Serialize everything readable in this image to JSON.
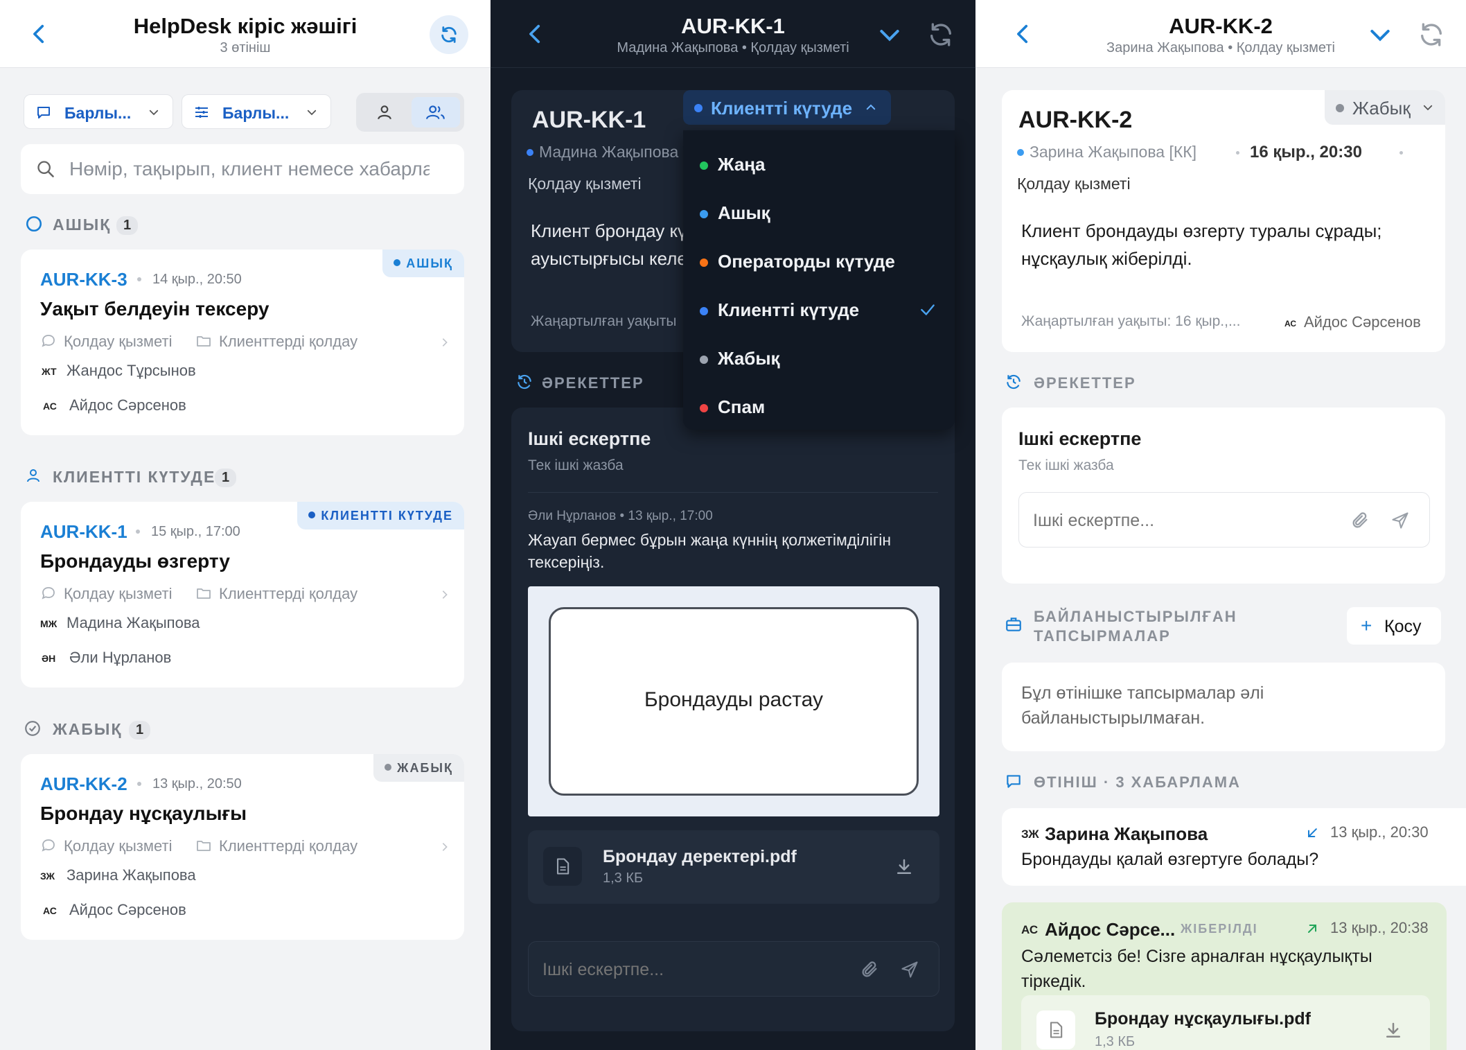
{
  "inbox": {
    "title": "HelpDesk кіріс жәшігі",
    "subtitle": "3 өтініш",
    "filter1": "Барлы...",
    "filter2": "Барлы...",
    "search_placeholder": "Нөмір, тақырып, клиент немесе хабарлама",
    "sections": [
      {
        "label": "АШЫҚ",
        "count": "1"
      },
      {
        "label": "КЛИЕНТТІ КҮТУДЕ",
        "count": "1"
      },
      {
        "label": "ЖАБЫҚ",
        "count": "1"
      }
    ],
    "tickets": [
      {
        "id": "AUR-KK-3",
        "date": "14 қыр., 20:50",
        "title": "Уақыт белдеуін тексеру",
        "badge": "АШЫҚ",
        "channel": "Қолдау қызметі",
        "queue": "Клиенттерді қолдау",
        "client_initials": "ЖТ",
        "client": "Жандос Тұрсынов",
        "agent_initials": "АС",
        "agent": "Айдос Сәрсенов"
      },
      {
        "id": "AUR-KK-1",
        "date": "15 қыр., 17:00",
        "title": "Брондауды өзгерту",
        "badge": "КЛИЕНТТІ КҮТУДЕ",
        "channel": "Қолдау қызметі",
        "queue": "Клиенттерді қолдау",
        "client_initials": "МЖ",
        "client": "Мадина Жақыпова",
        "agent_initials": "ӘН",
        "agent": "Әли Нұрланов"
      },
      {
        "id": "AUR-KK-2",
        "date": "13 қыр., 20:50",
        "title": "Брондау нұсқаулығы",
        "badge": "ЖАБЫҚ",
        "channel": "Қолдау қызметі",
        "queue": "Клиенттерді қолдау",
        "client_initials": "ЗЖ",
        "client": "Зарина Жақыпова",
        "agent_initials": "АС",
        "agent": "Айдос Сәрсенов"
      }
    ]
  },
  "detail1": {
    "title": "AUR-KK-1",
    "subtitle": "Мадина Жақыпова • Қолдау қызметі",
    "ticket_id": "AUR-KK-1",
    "status": "Клиентті күтуде",
    "client": "Мадина Жақыпова",
    "channel": "Қолдау қызметі",
    "summary_line1": "Клиент брондау күнін",
    "summary_line2": "ауыстырғысы келеді.",
    "updated": "Жаңартылған уақыты",
    "actions_label": "ӘРЕКЕТТЕР",
    "note_title": "Ішкі ескертпе",
    "note_sub": "Тек ішкі жазба",
    "note_author": "Әли Нұрланов • 13 қыр., 17:00",
    "note_text_line1": "Жауап бермес бұрын жаңа күннің қолжетімділігін",
    "note_text_line2": "тексеріңіз.",
    "preview_label": "Брондауды растау",
    "file_name": "Брондау деректері.pdf",
    "file_size": "1,3 КБ",
    "input_placeholder": "Ішкі ескертпе...",
    "menu": [
      {
        "label": "Жаңа",
        "color": "#22c55e"
      },
      {
        "label": "Ашық",
        "color": "#3b9cf0"
      },
      {
        "label": "Операторды күтуде",
        "color": "#f97316"
      },
      {
        "label": "Клиентті күтуде",
        "color": "#3b82f6",
        "selected": true
      },
      {
        "label": "Жабық",
        "color": "#9ca3af"
      },
      {
        "label": "Спам",
        "color": "#ef4444"
      }
    ]
  },
  "detail2": {
    "title": "AUR-KK-2",
    "subtitle": "Зарина Жақыпова • Қолдау қызметі",
    "ticket_id": "AUR-KK-2",
    "status": "Жабық",
    "client": "Зарина Жақыпова [КК]",
    "date": "16 қыр., 20:30",
    "channel": "Қолдау қызметі",
    "summary_line1": "Клиент брондауды өзгерту туралы сұрады;",
    "summary_line2": "нұсқаулық жіберілді.",
    "updated": "Жаңартылған уақыты: 16 қыр.,...",
    "agent_initials": "АС",
    "agent": "Айдос Сәрсенов",
    "actions_label": "ӘРЕКЕТТЕР",
    "note_title": "Ішкі ескертпе",
    "note_sub": "Тек ішкі жазба",
    "note_placeholder": "Ішкі ескертпе...",
    "linked_label_line1": "БАЙЛАНЫСТЫРЫЛҒАН",
    "linked_label_line2": "ТАПСЫРМАЛАР",
    "add_label": "Қосу",
    "linked_empty_line1": "Бұл өтінішке тапсырмалар әлі",
    "linked_empty_line2": "байланыстырылмаған.",
    "thread_label": "ӨТІНІШ · 3 ХАБАРЛАМА",
    "messages": [
      {
        "initials": "ЗЖ",
        "author": "Зарина Жақыпова",
        "time": "13 қыр., 20:30",
        "text": "Брондауды қалай өзгертуге болады?"
      },
      {
        "initials": "АС",
        "author": "Айдос Сәрсе...",
        "tag": "ЖІБЕРІЛДІ",
        "time": "13 қыр., 20:38",
        "text_line1": "Сәлеметсіз бе! Сізге арналған нұсқаулықты",
        "text_line2": "тіркедік.",
        "file_name": "Брондау нұсқаулығы.pdf",
        "file_size": "1,3 КБ"
      }
    ]
  }
}
